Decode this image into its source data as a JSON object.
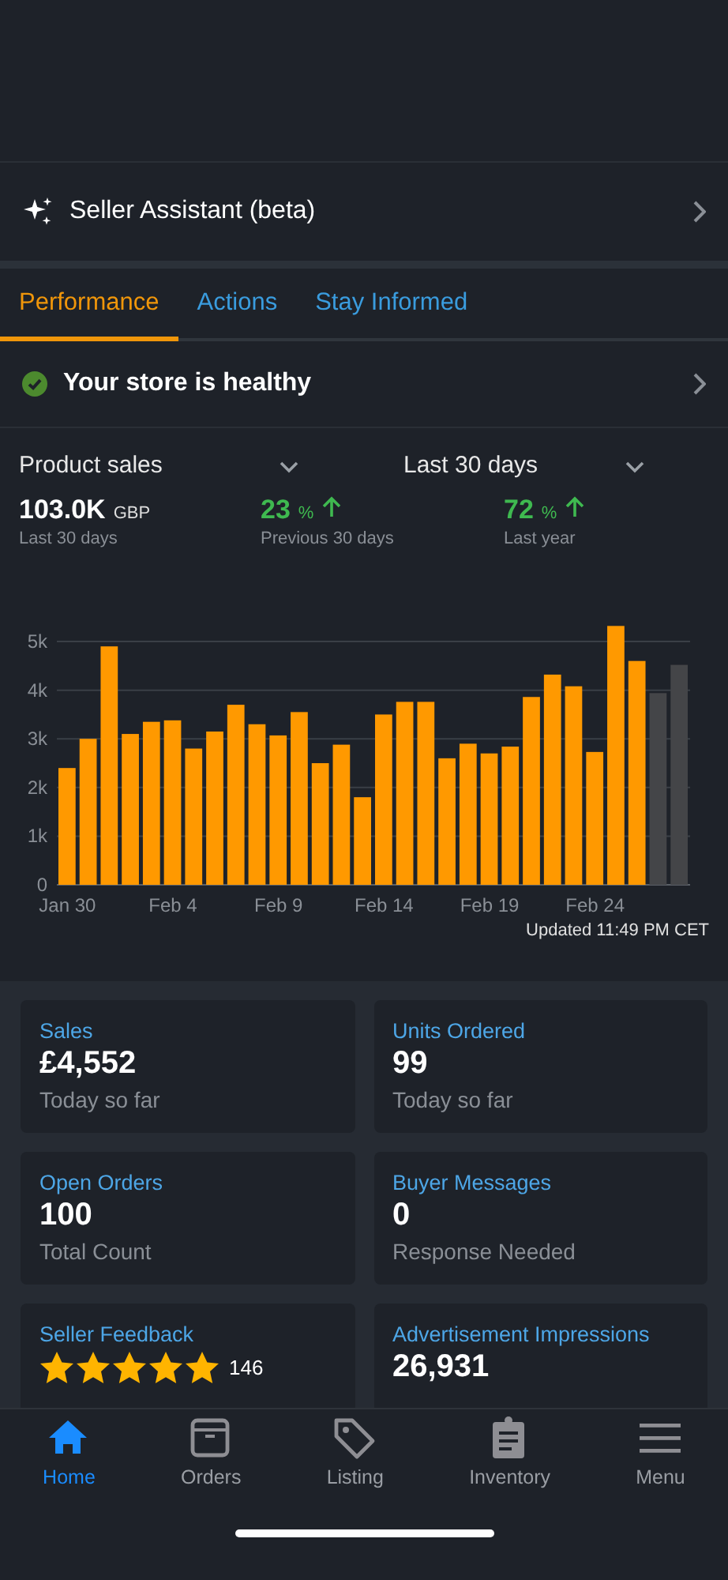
{
  "assistant": {
    "label": "Seller Assistant (beta)"
  },
  "tabs": [
    {
      "label": "Performance",
      "selected": true
    },
    {
      "label": "Actions",
      "selected": false
    },
    {
      "label": "Stay Informed",
      "selected": false
    }
  ],
  "health": {
    "label": "Your store is healthy",
    "healthy": true
  },
  "selectors": [
    {
      "label": "Product sales"
    },
    {
      "label": "Last 30 days"
    }
  ],
  "stats": [
    {
      "value": "103.0K",
      "unit": "GBP",
      "caption": "Last 30 days",
      "kind": "total"
    },
    {
      "value": "23",
      "unit": "%",
      "caption": "Previous 30 days",
      "kind": "change"
    },
    {
      "value": "72",
      "unit": "%",
      "caption": "Last year",
      "kind": "change"
    }
  ],
  "chart": {
    "chart_data": {
      "type": "bar",
      "categories": [
        "Jan 30",
        null,
        null,
        null,
        null,
        "Feb 4",
        null,
        null,
        null,
        null,
        "Feb 9",
        null,
        null,
        null,
        null,
        "Feb 14",
        null,
        null,
        null,
        null,
        "Feb 19",
        null,
        null,
        null,
        null,
        "Feb 24",
        null,
        null,
        null,
        null
      ],
      "series": [
        {
          "color": "#ff9900",
          "values": [
            2400,
            3000,
            4900,
            3100,
            3350,
            3380,
            2800,
            3150,
            3700,
            3300,
            3070,
            3550,
            2500,
            2880,
            1800,
            3500,
            3760,
            3760,
            2600,
            2900,
            2700,
            2840,
            3860,
            4320,
            4080,
            2730,
            5320,
            4600,
            null,
            null
          ]
        },
        {
          "color": "#444548",
          "values": [
            null,
            null,
            null,
            null,
            null,
            null,
            null,
            null,
            null,
            null,
            null,
            null,
            null,
            null,
            null,
            null,
            null,
            null,
            null,
            null,
            null,
            null,
            null,
            null,
            null,
            null,
            null,
            null,
            3940,
            4520
          ]
        }
      ],
      "ylim": [
        0,
        5400
      ],
      "grid": true,
      "yticks": [
        {
          "value": 0,
          "label": "0"
        },
        {
          "value": 1000,
          "label": "1k"
        },
        {
          "value": 2000,
          "label": "2k"
        },
        {
          "value": 3000,
          "label": "3k"
        },
        {
          "value": 4000,
          "label": "4k"
        },
        {
          "value": 5000,
          "label": "5k"
        }
      ]
    },
    "updated": "Updated 11:49 PM CET"
  },
  "cards": [
    {
      "title": "Sales",
      "value": "£4,552",
      "caption": "Today so far",
      "kind": "metric"
    },
    {
      "title": "Units Ordered",
      "value": "99",
      "caption": "Today so far",
      "kind": "metric"
    },
    {
      "title": "Open Orders",
      "value": "100",
      "caption": "Total Count",
      "kind": "metric"
    },
    {
      "title": "Buyer Messages",
      "value": "0",
      "caption": "Response Needed",
      "kind": "metric"
    },
    {
      "title": "Seller Feedback",
      "stars": 5,
      "count": "146",
      "kind": "rating"
    },
    {
      "title": "Advertisement Impressions",
      "value": "26,931",
      "kind": "metric"
    }
  ],
  "nav": [
    {
      "label": "Home",
      "selected": true
    },
    {
      "label": "Orders",
      "selected": false
    },
    {
      "label": "Listing",
      "selected": false
    },
    {
      "label": "Inventory",
      "selected": false
    },
    {
      "label": "Menu",
      "selected": false
    }
  ]
}
